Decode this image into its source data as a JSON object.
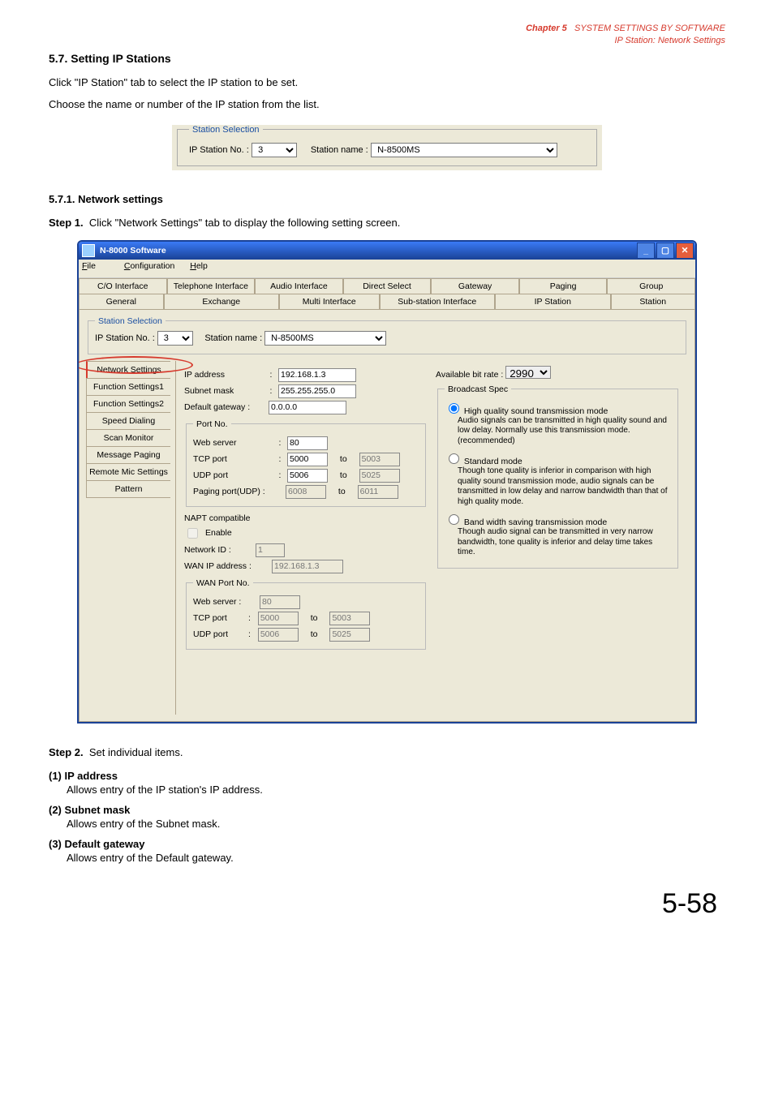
{
  "chapter": {
    "tag": "Chapter 5",
    "title1": "SYSTEM SETTINGS BY SOFTWARE",
    "title2": "IP Station: Network Settings"
  },
  "section_title": "5.7. Setting IP Stations",
  "para1": "Click \"IP Station\" tab to select the IP station to be set.",
  "para2": "Choose the name or number of the IP station from the list.",
  "selbox": {
    "legend": "Station Selection",
    "lbl_no": "IP Station No. :",
    "val_no": "3",
    "lbl_name": "Station name :",
    "val_name": "N-8500MS"
  },
  "sub_head": "5.7.1. Network settings",
  "step1": {
    "prefix": "Step 1.",
    "text": "Click \"Network Settings\" tab to display the following setting screen."
  },
  "app": {
    "title": "N-8000 Software",
    "menu": {
      "file": "File",
      "config": "Configuration",
      "help": "Help"
    },
    "tabs_row1": [
      "C/O Interface",
      "Telephone Interface",
      "Audio Interface",
      "Direct Select",
      "Gateway",
      "Paging",
      "Group"
    ],
    "tabs_row2": [
      "General",
      "Exchange",
      "Multi Interface",
      "Sub-station Interface",
      "IP Station",
      "Station"
    ],
    "sel": {
      "legend": "Station Selection",
      "lbl_no": "IP Station No. :",
      "val_no": "3",
      "lbl_name": "Station name :",
      "val_name": "N-8500MS"
    },
    "vtabs": [
      "Network Settings",
      "Function Settings1",
      "Function Settings2",
      "Speed Dialing",
      "Scan Monitor",
      "Message Paging",
      "Remote Mic Settings",
      "Pattern"
    ],
    "fields": {
      "ip_lbl": "IP address",
      "ip": "192.168.1.3",
      "mask_lbl": "Subnet mask",
      "mask": "255.255.255.0",
      "gw_lbl": "Default gateway :",
      "gw": "0.0.0.0",
      "port_legend": "Port No.",
      "web_lbl": "Web server",
      "web": "80",
      "tcp_lbl": "TCP port",
      "tcp_a": "5000",
      "to": "to",
      "tcp_b": "5003",
      "udp_lbl": "UDP port",
      "udp_a": "5006",
      "udp_b": "5025",
      "pag_lbl": "Paging port(UDP) :",
      "pag_a": "6008",
      "pag_b": "6011",
      "rate_lbl": "Available bit rate :",
      "rate": "2990",
      "bcast_legend": "Broadcast Spec",
      "r1": "High quality sound transmission mode",
      "r1d": "Audio signals can be transmitted in high quality sound and low delay. Normally use this transmission mode.(recommended)",
      "r2": "Standard mode",
      "r2d": "Though tone quality is inferior in comparison with high quality sound transmission mode, audio signals can be transmitted in low delay and narrow bandwidth than that of high quality mode.",
      "r3": "Band width saving transmission mode",
      "r3d": "Though audio signal can be transmitted in very narrow bandwidth, tone quality is inferior and delay time takes time.",
      "napt": "NAPT compatible",
      "en": "Enable",
      "nid_lbl": "Network ID :",
      "nid": "1",
      "wip_lbl": "WAN IP address :",
      "wip": "192.168.1.3",
      "wan_legend": "WAN Port No.",
      "wweb_lbl": "Web server :",
      "wweb": "80",
      "wtcp_lbl": "TCP port",
      "wtcp_a": "5000",
      "wtcp_b": "5003",
      "wudp_lbl": "UDP port",
      "wudp_a": "5006",
      "wudp_b": "5025"
    }
  },
  "step2": {
    "prefix": "Step 2.",
    "text": "Set individual items."
  },
  "items": {
    "i1h": "(1)  IP address",
    "i1b": "Allows entry of the IP station's IP address.",
    "i2h": "(2)  Subnet mask",
    "i2b": "Allows entry of the Subnet mask.",
    "i3h": "(3)  Default gateway",
    "i3b": "Allows entry of the Default gateway."
  },
  "pagenum": "5-58"
}
